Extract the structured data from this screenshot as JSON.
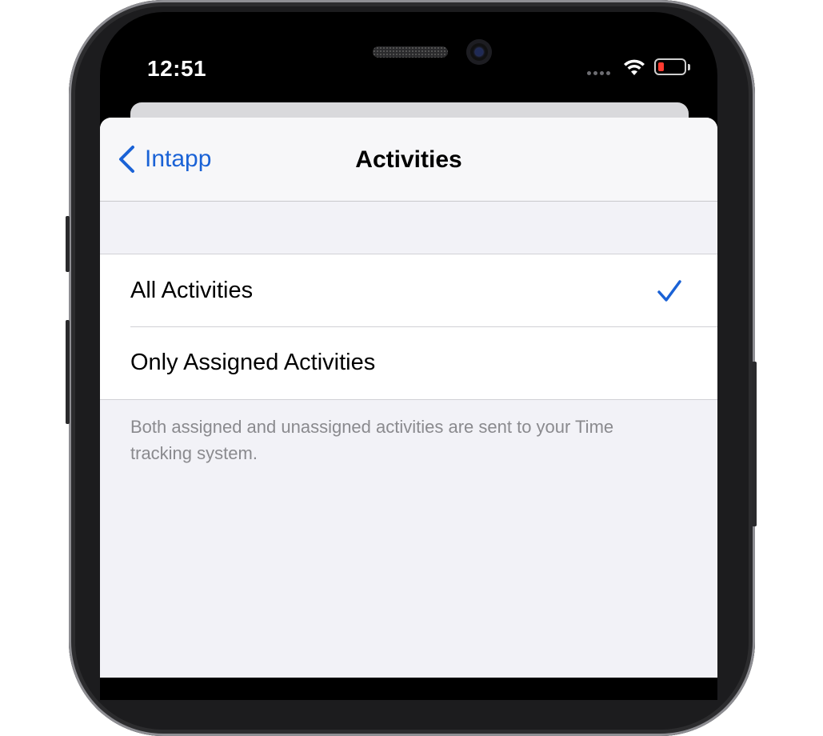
{
  "status_bar": {
    "time": "12:51",
    "signal_icon": "cellular-signal-icon",
    "wifi_icon": "wifi-icon",
    "battery_icon": "battery-low-icon",
    "battery_color": "#ff3b30"
  },
  "nav": {
    "back_label": "Intapp",
    "back_icon": "chevron-left-icon",
    "title": "Activities"
  },
  "options": [
    {
      "label": "All Activities",
      "selected": true
    },
    {
      "label": "Only Assigned Activities",
      "selected": false
    }
  ],
  "footer_note": "Both assigned and unassigned activities are sent to your Time tracking system.",
  "colors": {
    "accent": "#1a62d6",
    "background": "#f2f2f7",
    "secondary_text": "#8a8a8e"
  }
}
